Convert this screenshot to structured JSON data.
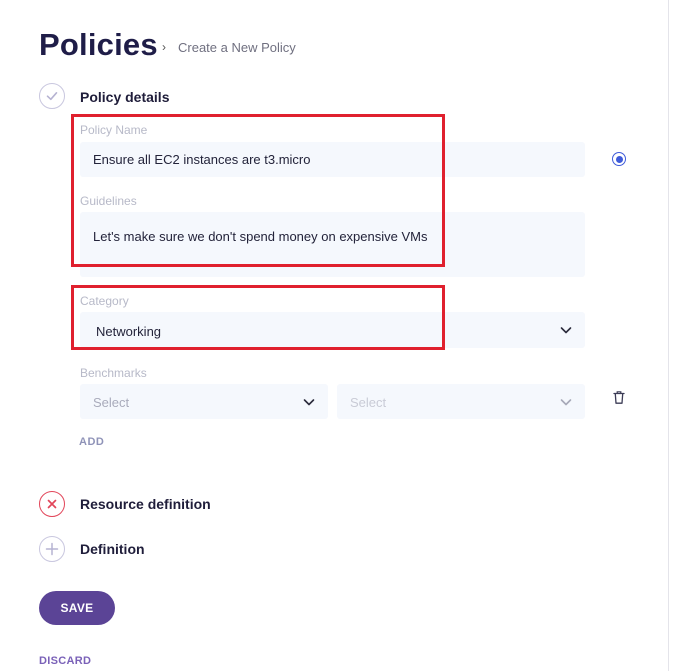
{
  "header": {
    "title": "Policies",
    "breadcrumb_separator": "›",
    "breadcrumb": "Create a New Policy"
  },
  "steps": {
    "policy_details": {
      "label": "Policy details",
      "status": "completed",
      "icon": "check-icon"
    },
    "resource_definition": {
      "label": "Resource definition",
      "status": "error",
      "icon": "x-icon"
    },
    "definition": {
      "label": "Definition",
      "status": "pending",
      "icon": "plus-icon"
    }
  },
  "form": {
    "policy_name": {
      "label": "Policy Name",
      "value": "Ensure all EC2 instances are t3.micro"
    },
    "guidelines": {
      "label": "Guidelines",
      "value": "Let's make sure we don't spend money on expensive VMs"
    },
    "category": {
      "label": "Category",
      "value": "Networking"
    },
    "benchmarks": {
      "label": "Benchmarks",
      "select_1_placeholder": "Select",
      "select_2_placeholder": "Select",
      "add_label": "ADD"
    }
  },
  "actions": {
    "save_label": "SAVE",
    "discard_label": "DISCARD"
  },
  "colors": {
    "accent": "#5b4496",
    "error": "#e0202e",
    "radio": "#3f5bd9",
    "field_bg": "#f5f8fd",
    "title": "#1f1d48"
  }
}
